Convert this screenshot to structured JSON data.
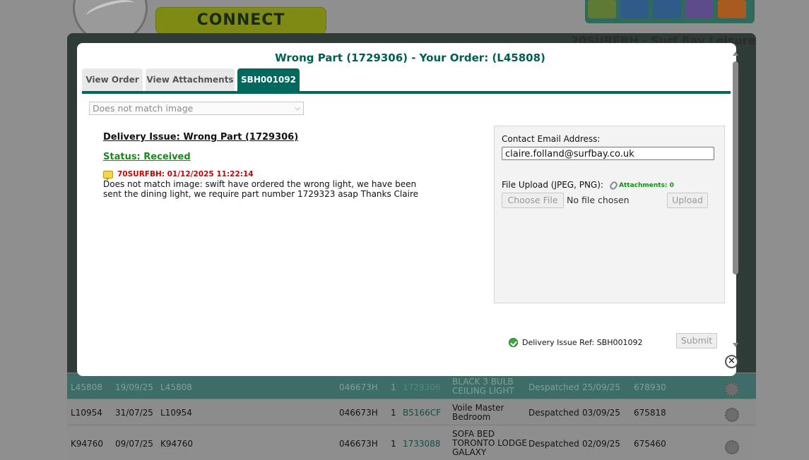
{
  "background": {
    "logo_text": "CONNECT",
    "site_title": "70SURFBH - Surf Bay Leisure",
    "icon_colors": [
      "#6f8a3a",
      "#2f5a9a",
      "#2f5a9a",
      "#6a4fa0",
      "#c8641e"
    ],
    "table_rows": [
      {
        "order": "L45808",
        "date": "19/09/25",
        "ref": "L45808",
        "code": "046673H",
        "qty": "1",
        "part": "1729306",
        "desc": [
          "BLACK 3 BULB",
          "CEILING LIGHT"
        ],
        "status": "Despatched",
        "desp_date": "25/09/25",
        "invoice": "678930"
      },
      {
        "order": "L10954",
        "date": "31/07/25",
        "ref": "L10954",
        "code": "046673H",
        "qty": "1",
        "part": "B5166CF",
        "desc": [
          "Voile Master",
          "Bedroom"
        ],
        "status": "Despatched",
        "desp_date": "03/09/25",
        "invoice": "675818"
      },
      {
        "order": "K94760",
        "date": "09/07/25",
        "ref": "K94760",
        "code": "046673H",
        "qty": "1",
        "part": "1733088",
        "desc": [
          "SOFA BED",
          "TORONTO LODGE",
          "GALAXY"
        ],
        "status": "Despatched",
        "desp_date": "02/09/25",
        "invoice": "675460"
      }
    ]
  },
  "modal": {
    "title": "Wrong Part (1729306) - Your Order: (L45808)",
    "tabs": [
      "View Order",
      "View Attachments",
      "SBH001092"
    ],
    "active_tab": "SBH001092",
    "issue_select_value": "Does not match image",
    "issue_heading": "Delivery Issue: Wrong Part (1729306)",
    "status": "Status: Received",
    "note": {
      "meta": "70SURFBH: 01/12/2025 11:22:14",
      "text": "Does not match image: swift have ordered the wrong light, we have been sent the dining light, we require part number 1729323 asap Thanks Claire"
    },
    "contact": {
      "email_label": "Contact Email Address:",
      "email_value": "claire.folland@surfbay.co.uk",
      "upload_label": "File Upload (JPEG, PNG):",
      "attachments_label": "Attachments: 0",
      "choose_file": "Choose File",
      "no_file": "No file chosen",
      "upload_button": "Upload"
    },
    "reference": "Delivery Issue Ref: SBH001092",
    "submit_button": "Submit",
    "close_symbol": "×"
  }
}
